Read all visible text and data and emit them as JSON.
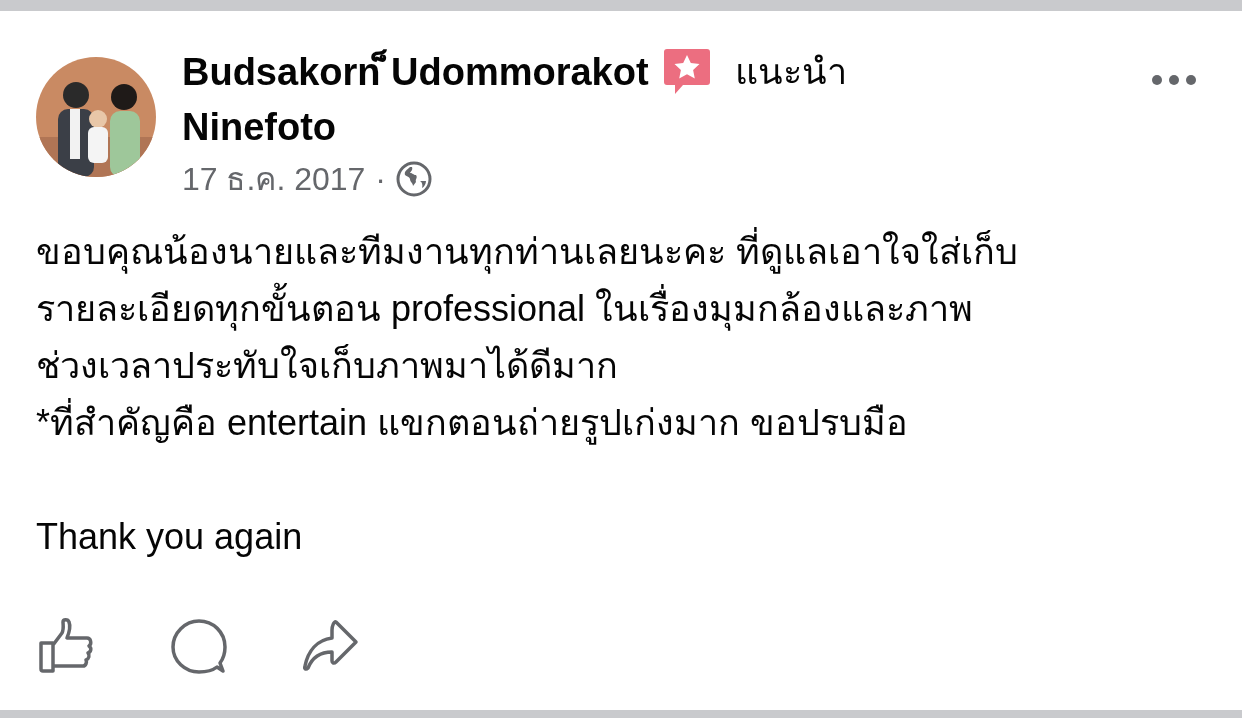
{
  "post": {
    "author": "Budsakorn ็Udommorakot",
    "badge": "แนะนำ",
    "page": "Ninefoto",
    "date": "17 ธ.ค. 2017",
    "separator": "·",
    "paragraphs": [
      "ขอบคุณน้องนายและทีมงานทุกท่านเลยนะคะ ที่ดูแลเอาใจใส่เก็บ\nรายละเอียดทุกขั้นตอน professional ในเรื่องมุมกล้องและภาพ\nช่วงเวลาประทับใจเก็บภาพมาได้ดีมาก\n*ที่สำคัญคือ entertain แขกตอนถ่ายรูปเก่งมาก ขอปรบมือ",
      "Thank you again"
    ]
  }
}
